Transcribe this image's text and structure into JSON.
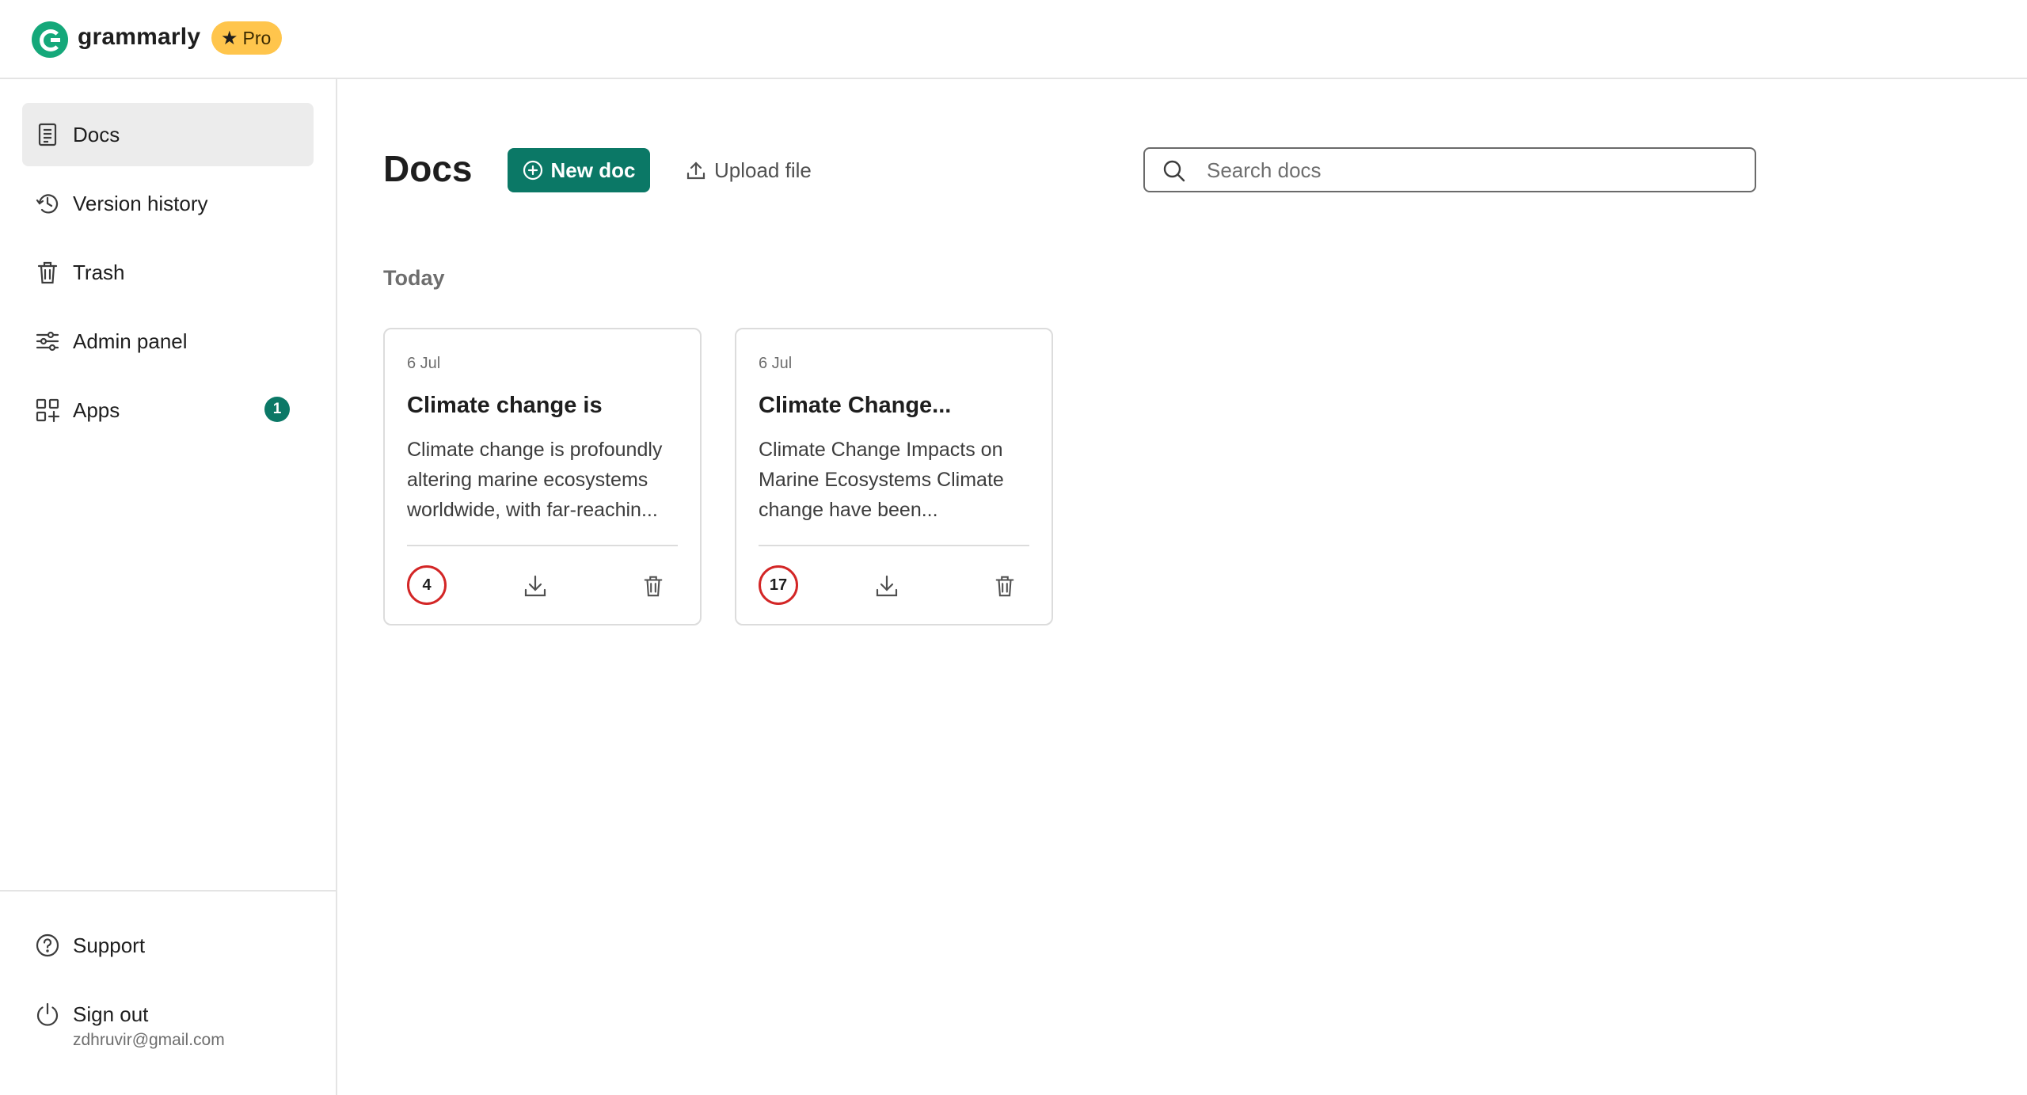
{
  "header": {
    "brand": "grammarly",
    "pro_label": "Pro"
  },
  "sidebar": {
    "items": [
      {
        "label": "Docs",
        "icon": "docs-icon",
        "active": true
      },
      {
        "label": "Version history",
        "icon": "history-icon",
        "active": false
      },
      {
        "label": "Trash",
        "icon": "trash-icon",
        "active": false
      },
      {
        "label": "Admin panel",
        "icon": "sliders-icon",
        "active": false
      },
      {
        "label": "Apps",
        "icon": "apps-grid-icon",
        "active": false,
        "badge": "1"
      }
    ],
    "bottom_items": [
      {
        "label": "Support",
        "icon": "help-circle-icon"
      },
      {
        "label": "Sign out",
        "icon": "power-icon",
        "sublabel": "zdhruvir@gmail.com"
      }
    ]
  },
  "main": {
    "title": "Docs",
    "new_doc_label": "New doc",
    "upload_label": "Upload file",
    "search": {
      "placeholder": "Search docs",
      "value": ""
    },
    "section_label": "Today",
    "docs": [
      {
        "date": "6 Jul",
        "title": "Climate change is",
        "preview": "Climate change is profoundly altering marine ecosystems worldwide, with far-reachin...",
        "score": "4"
      },
      {
        "date": "6 Jul",
        "title": "Climate Change...",
        "preview": "Climate Change Impacts on Marine Ecosystems Climate change have been...",
        "score": "17"
      }
    ]
  },
  "colors": {
    "brand_green": "#15a87a",
    "primary_button": "#0b7866",
    "pro_badge": "#ffc54c",
    "score_ring": "#d32626",
    "active_nav": "#ececec"
  }
}
